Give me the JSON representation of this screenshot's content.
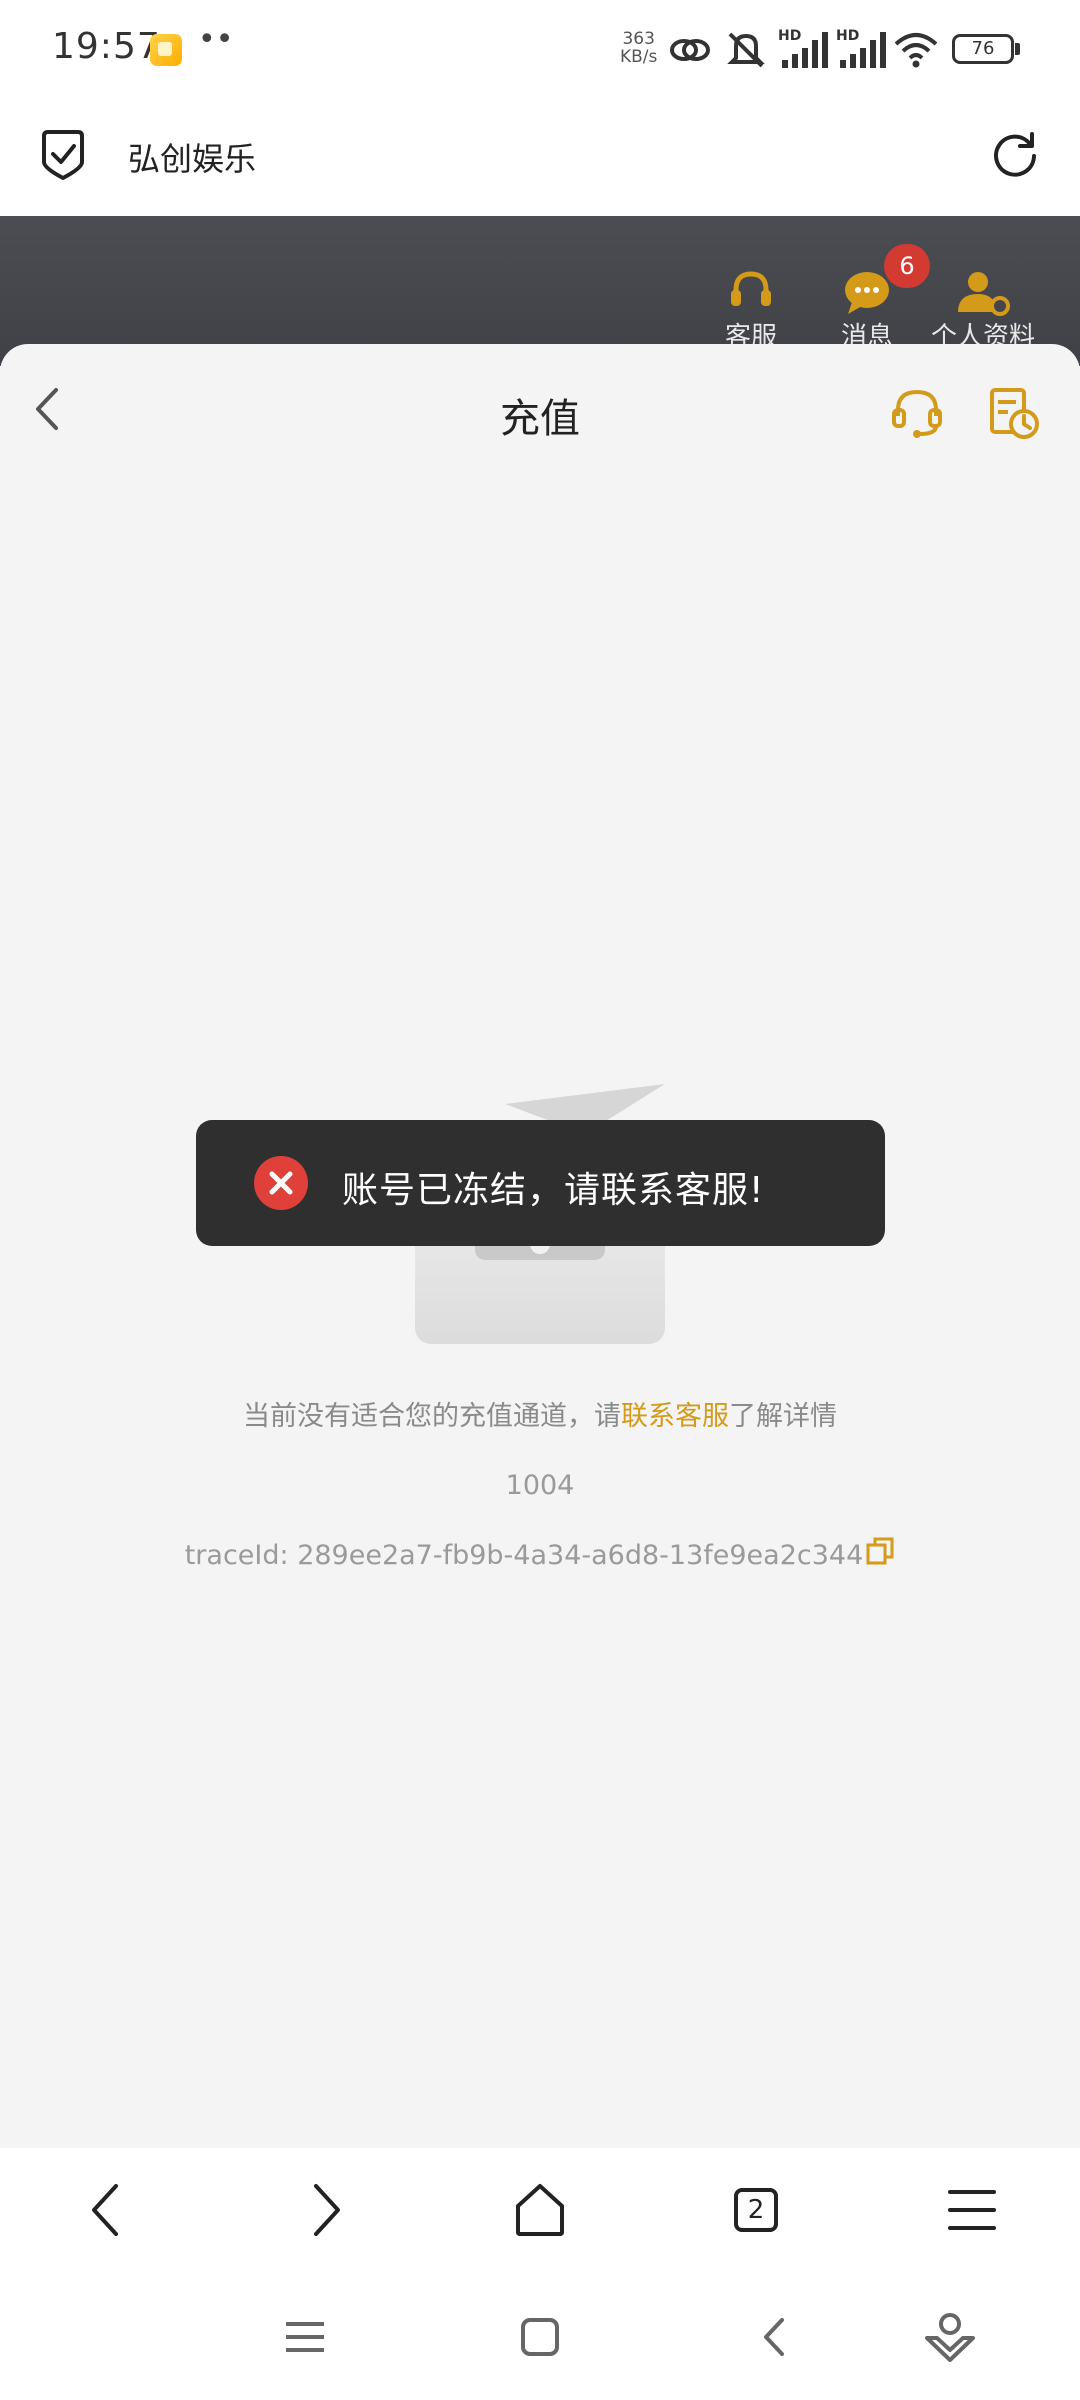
{
  "status_bar": {
    "time": "19:57",
    "net_speed_value": "363",
    "net_speed_unit": "KB/s",
    "signal_1_label": "HD",
    "signal_2_label": "HD",
    "battery": "76"
  },
  "browser": {
    "site_title": "弘创娱乐",
    "tab_count": "2"
  },
  "site_header": {
    "items": [
      {
        "label": "客服",
        "icon": "headset-icon"
      },
      {
        "label": "消息",
        "icon": "chat-bubble-icon",
        "badge": "6"
      },
      {
        "label": "个人资料",
        "icon": "user-settings-icon"
      }
    ]
  },
  "recharge": {
    "title": "充值",
    "empty_message_prefix": "当前没有适合您的充值通道，请",
    "empty_message_link": "联系客服",
    "empty_message_suffix": "了解详情",
    "error_code": "1004",
    "trace_id": "traceId: 289ee2a7-fb9b-4a34-a6d8-13fe9ea2c344"
  },
  "toast": {
    "message": "账号已冻结，请联系客服!"
  },
  "colors": {
    "accent": "#d49a1a",
    "error": "#e0403a",
    "sheet_bg": "#f4f4f5"
  }
}
